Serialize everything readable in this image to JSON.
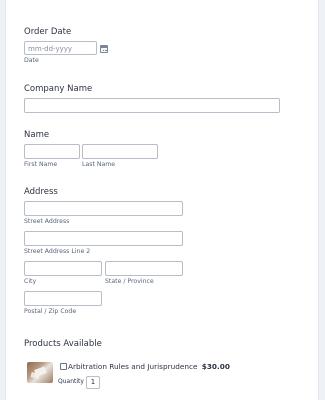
{
  "order_date": {
    "label": "Order Date",
    "placeholder": "mm-dd-yyyy",
    "sublabel": "Date",
    "calendar_icon": "calendar-icon"
  },
  "company": {
    "label": "Company Name"
  },
  "name": {
    "label": "Name",
    "first_sublabel": "First Name",
    "last_sublabel": "Last Name"
  },
  "address": {
    "label": "Address",
    "street_sublabel": "Street Address",
    "street2_sublabel": "Street Address Line 2",
    "city_sublabel": "City",
    "state_sublabel": "State / Province",
    "zip_sublabel": "Postal / Zip Code"
  },
  "products": {
    "label": "Products Available",
    "items": [
      {
        "name": "Arbitration Rules and Jurisprudence",
        "price": "$30.00",
        "quantity_label": "Quantity",
        "quantity_value": "1",
        "image_icon": "book-thumbnail-icon"
      }
    ]
  }
}
